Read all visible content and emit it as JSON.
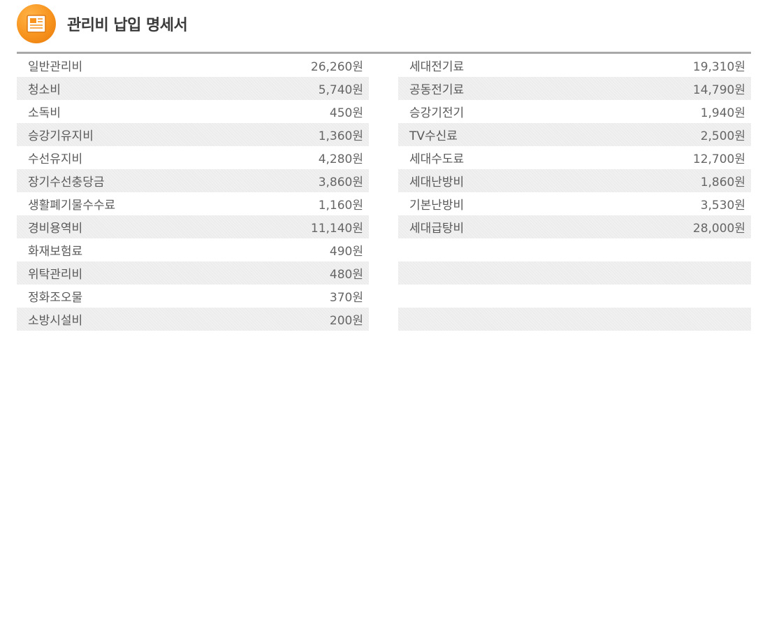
{
  "header": {
    "title": "관리비 납입 명세서",
    "icon": "receipt-document-icon",
    "icon_color": "#f7931e"
  },
  "left_items": [
    {
      "label": "일반관리비",
      "value": "26,260원"
    },
    {
      "label": "청소비",
      "value": "5,740원"
    },
    {
      "label": "소독비",
      "value": "450원"
    },
    {
      "label": "승강기유지비",
      "value": "1,360원"
    },
    {
      "label": "수선유지비",
      "value": "4,280원"
    },
    {
      "label": "장기수선충당금",
      "value": "3,860원"
    },
    {
      "label": "생활폐기물수수료",
      "value": "1,160원"
    },
    {
      "label": "경비용역비",
      "value": "11,140원"
    },
    {
      "label": "화재보험료",
      "value": "490원"
    },
    {
      "label": "위탁관리비",
      "value": "480원"
    },
    {
      "label": "정화조오물",
      "value": "370원"
    },
    {
      "label": "소방시설비",
      "value": "200원"
    }
  ],
  "right_items": [
    {
      "label": "세대전기료",
      "value": "19,310원"
    },
    {
      "label": "공동전기료",
      "value": "14,790원"
    },
    {
      "label": "승강기전기",
      "value": "1,940원"
    },
    {
      "label": "TV수신료",
      "value": "2,500원"
    },
    {
      "label": "세대수도료",
      "value": "12,700원"
    },
    {
      "label": "세대난방비",
      "value": "1,860원"
    },
    {
      "label": "기본난방비",
      "value": "3,530원"
    },
    {
      "label": "세대급탕비",
      "value": "28,000원"
    },
    {
      "label": "",
      "value": ""
    },
    {
      "label": "",
      "value": ""
    },
    {
      "label": "",
      "value": ""
    },
    {
      "label": "",
      "value": ""
    }
  ]
}
